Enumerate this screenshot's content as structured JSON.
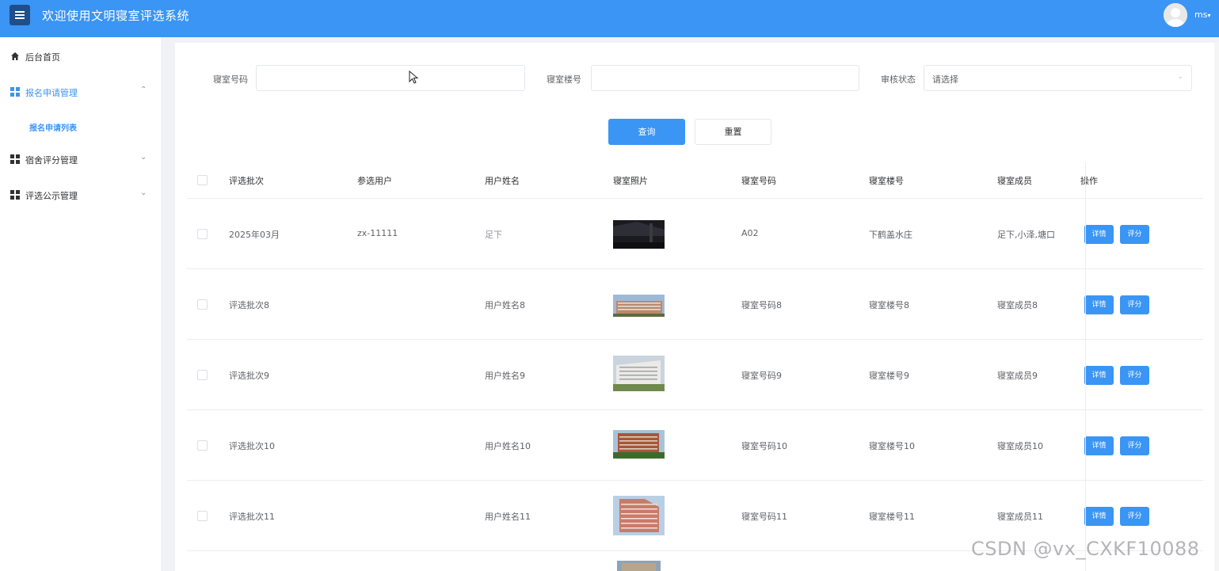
{
  "header": {
    "title": "欢迎使用文明寝室评选系统",
    "user_name": "ms",
    "caret": "▾",
    "bg_color": "#3a95f5"
  },
  "sidebar": {
    "items": [
      {
        "label": "后台首页",
        "icon": "home-icon",
        "arrow": ""
      },
      {
        "label": "报名申请管理",
        "icon": "grid-icon",
        "arrow": "⌃"
      },
      {
        "label": "宿舍评分管理",
        "icon": "grid-icon",
        "arrow": "⌄"
      },
      {
        "label": "评选公示管理",
        "icon": "grid-icon",
        "arrow": "⌄"
      }
    ],
    "sub_item": "报名申请列表"
  },
  "filters": {
    "room_no_label": "寝室号码",
    "room_no_value": "",
    "building_label": "寝室楼号",
    "building_value": "",
    "status_label": "审核状态",
    "status_value": "请选择",
    "query_label": "查询",
    "reset_label": "重置"
  },
  "table": {
    "columns": [
      "评选批次",
      "参选用户",
      "用户姓名",
      "寝室照片",
      "寝室号码",
      "寝室楼号",
      "寝室成员",
      "操作"
    ],
    "rows": [
      {
        "batch": "2025年03月",
        "user": "zx-11111",
        "name": "足下",
        "room_no": "A02",
        "building": "下鹤盖水庄",
        "members": "足下,小泽,塘口",
        "photo": "dark-dorm-photo"
      },
      {
        "batch": "评选批次8",
        "user": "",
        "name": "用户姓名8",
        "room_no": "寝室号码8",
        "building": "寝室楼号8",
        "members": "寝室成员8",
        "photo": "building-photo-8"
      },
      {
        "batch": "评选批次9",
        "user": "",
        "name": "用户姓名9",
        "room_no": "寝室号码9",
        "building": "寝室楼号9",
        "members": "寝室成员9",
        "photo": "building-photo-9"
      },
      {
        "batch": "评选批次10",
        "user": "",
        "name": "用户姓名10",
        "room_no": "寝室号码10",
        "building": "寝室楼号10",
        "members": "寝室成员10",
        "photo": "building-photo-10"
      },
      {
        "batch": "评选批次11",
        "user": "",
        "name": "用户姓名11",
        "room_no": "寝室号码11",
        "building": "寝室楼号11",
        "members": "寝室成员11",
        "photo": "building-photo-11"
      }
    ],
    "detail_label": "详情",
    "score_label": "评分"
  },
  "watermark": "CSDN @vx_CXKF10088",
  "accent_color": "#3a95f5"
}
